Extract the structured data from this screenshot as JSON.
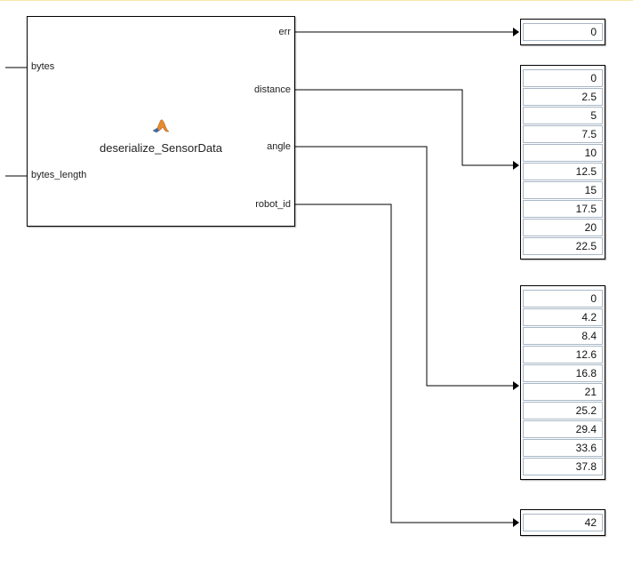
{
  "block": {
    "label": "deserialize_SensorData",
    "inputs": {
      "bytes": "bytes",
      "bytes_length": "bytes_length"
    },
    "outputs": {
      "err": "err",
      "distance": "distance",
      "angle": "angle",
      "robot_id": "robot_id"
    }
  },
  "displays": {
    "err": [
      "0"
    ],
    "distance": [
      "0",
      "2.5",
      "5",
      "7.5",
      "10",
      "12.5",
      "15",
      "17.5",
      "20",
      "22.5"
    ],
    "angle": [
      "0",
      "4.2",
      "8.4",
      "12.6",
      "16.8",
      "21",
      "25.2",
      "29.4",
      "33.6",
      "37.8"
    ],
    "robot_id": [
      "42"
    ]
  },
  "icon_name": "matlab-icon"
}
